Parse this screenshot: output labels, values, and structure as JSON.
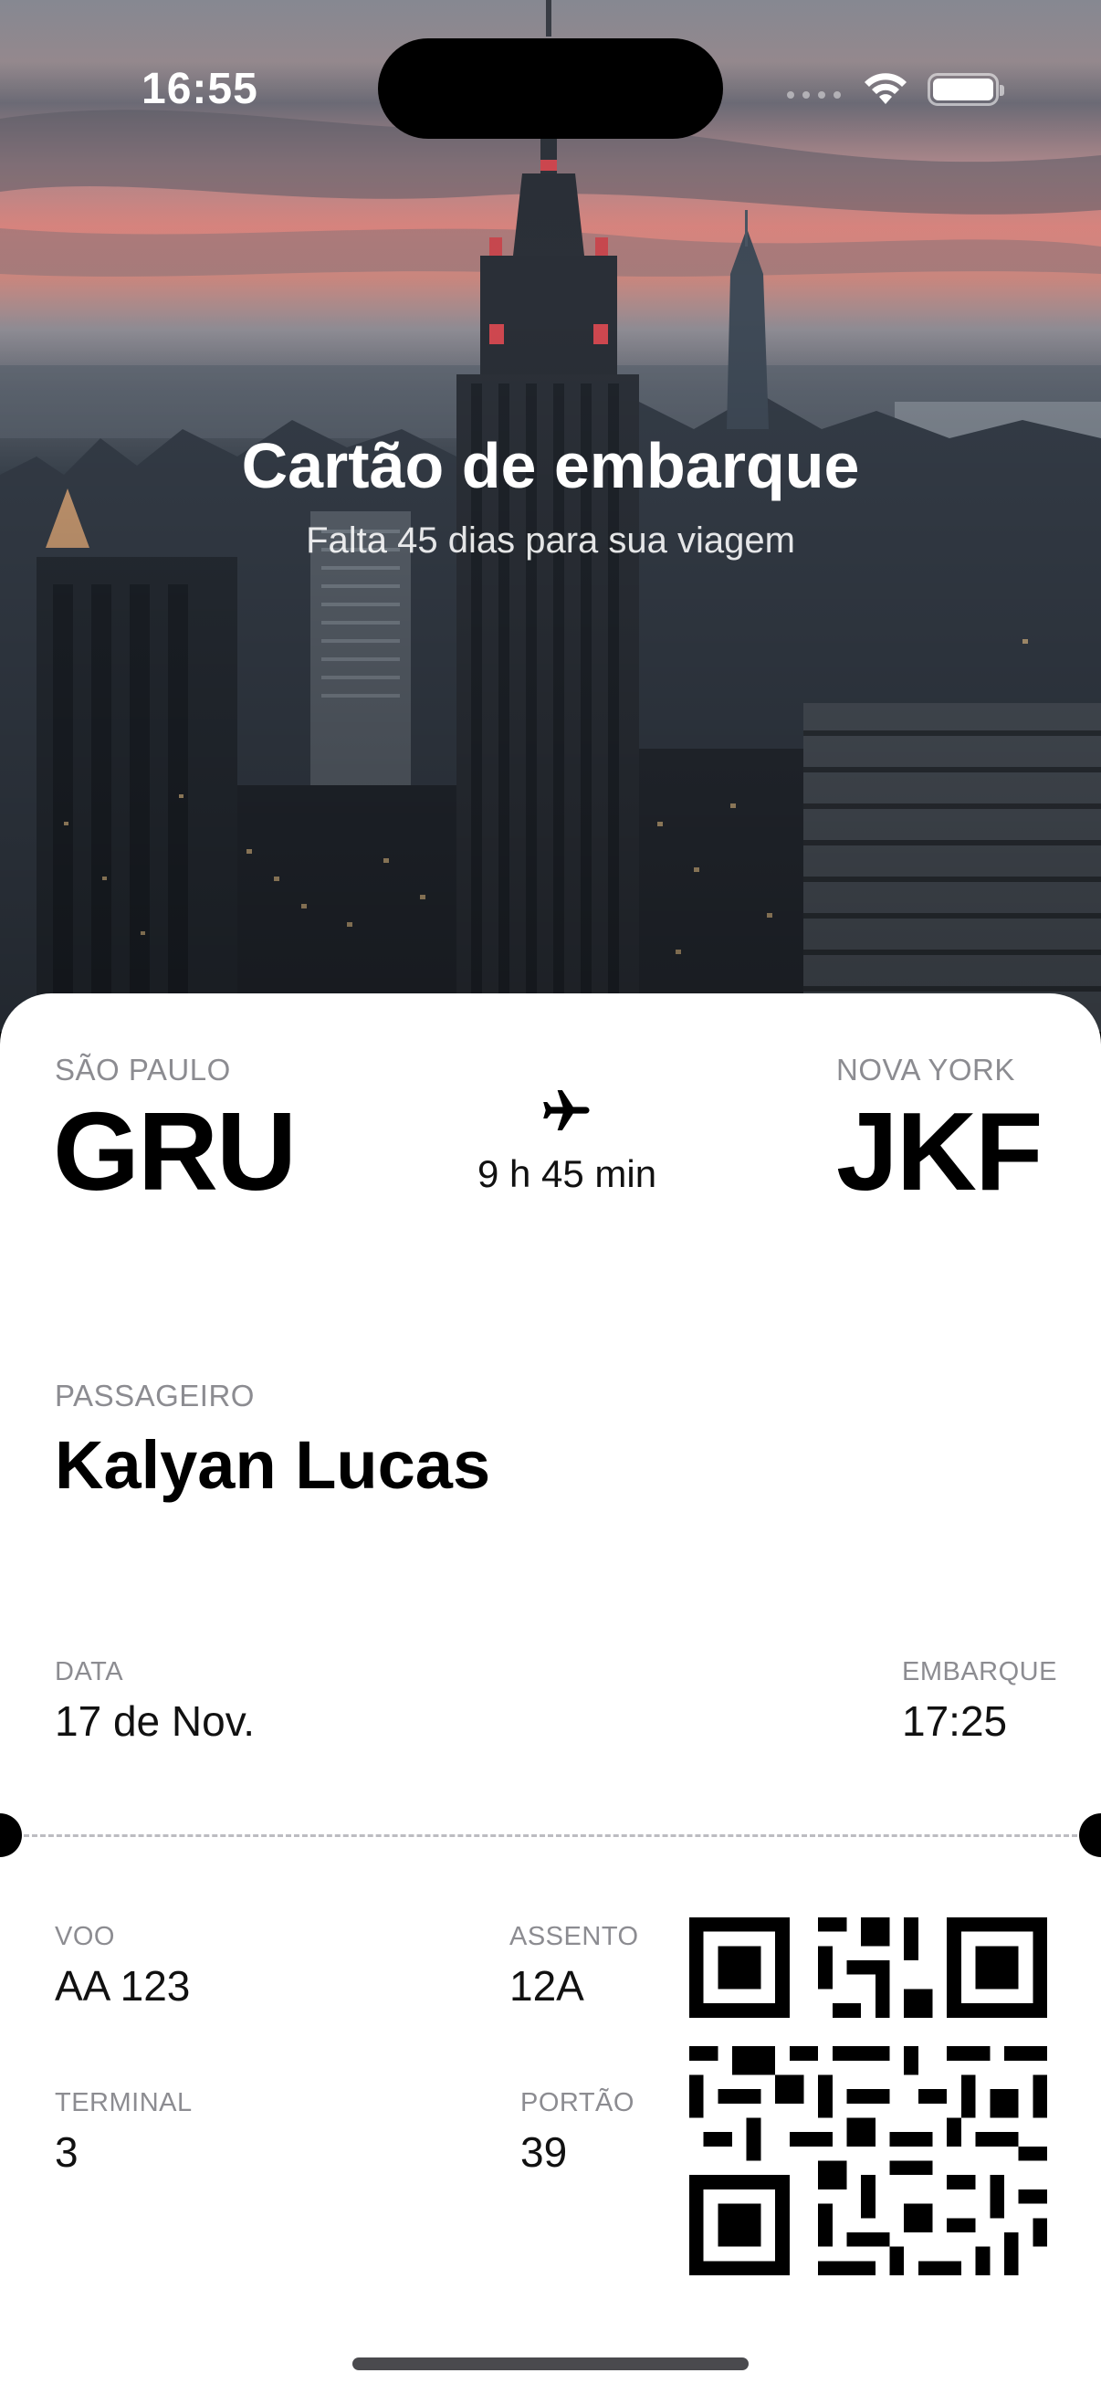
{
  "status_bar": {
    "time": "16:55"
  },
  "header": {
    "title": "Cartão de embarque",
    "subtitle": "Falta 45 dias para sua viagem"
  },
  "flight": {
    "origin": {
      "city": "SÃO PAULO",
      "code": "GRU"
    },
    "destination": {
      "city": "NOVA YORK",
      "code": "JKF"
    },
    "duration": "9 h 45 min"
  },
  "passenger": {
    "label": "PASSAGEIRO",
    "name": "Kalyan Lucas"
  },
  "schedule": {
    "date_label": "DATA",
    "date": "17 de Nov.",
    "boarding_label": "EMBARQUE",
    "boarding": "17:25"
  },
  "details": {
    "flight_label": "VOO",
    "flight": "AA 123",
    "seat_label": "ASSENTO",
    "seat": "12A",
    "terminal_label": "TERMINAL",
    "terminal": "3",
    "gate_label": "PORTÃO",
    "gate": "39"
  },
  "icons": {
    "plane": "airplane-icon",
    "wifi": "wifi-icon",
    "battery": "battery-icon",
    "qr": "qr-code"
  }
}
